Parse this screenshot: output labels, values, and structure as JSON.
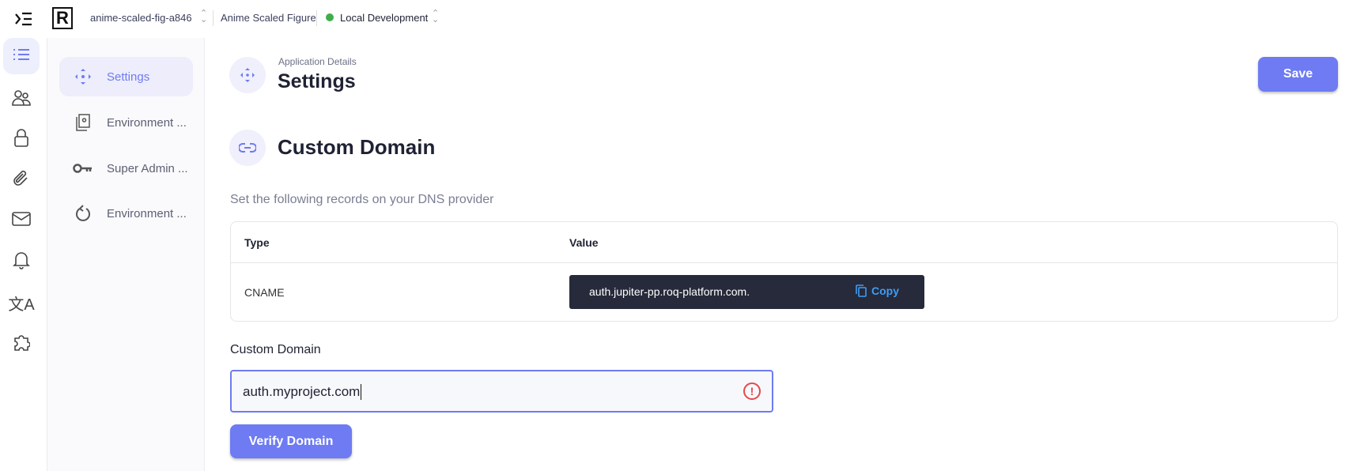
{
  "topbar": {
    "project_slug": "anime-scaled-fig-a846",
    "project_name": "Anime Scaled Figure",
    "environment": "Local Development",
    "environment_status_color": "#3fae4a"
  },
  "rail": {
    "items": [
      "list-icon",
      "users-icon",
      "lock-icon",
      "paperclip-icon",
      "mail-icon",
      "bell-icon",
      "translate-icon",
      "puzzle-icon"
    ]
  },
  "sidebar": {
    "items": [
      {
        "label": "Settings",
        "icon": "move-icon",
        "active": true
      },
      {
        "label": "Environment ...",
        "icon": "environment-config-icon"
      },
      {
        "label": "Super Admin ...",
        "icon": "key-icon"
      },
      {
        "label": "Environment ...",
        "icon": "refresh-icon"
      }
    ]
  },
  "header": {
    "breadcrumb": "Application Details",
    "title": "Settings",
    "save_label": "Save"
  },
  "section": {
    "title": "Custom Domain",
    "instructions": "Set the following records on your DNS provider",
    "table": {
      "columns": [
        "Type",
        "Value"
      ],
      "rows": [
        {
          "type": "CNAME",
          "value": "auth.jupiter-pp.roq-platform.com.",
          "copy_label": "Copy"
        }
      ]
    },
    "field_label": "Custom Domain",
    "field_value": "auth.myproject.com",
    "verify_label": "Verify Domain"
  },
  "colors": {
    "accent": "#6e7bf2",
    "dark": "#272a3a",
    "error": "#e5484d"
  }
}
